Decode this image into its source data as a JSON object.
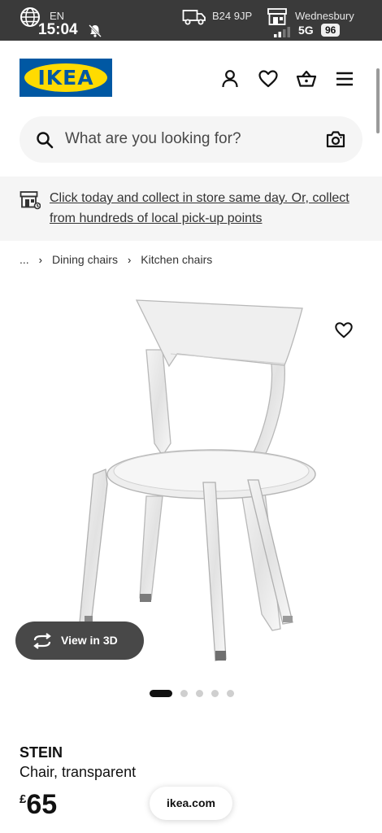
{
  "status_bar": {
    "lang": "EN",
    "time": "15:04",
    "postcode": "B24 9JP",
    "location": "Wednesbury",
    "network": "5G",
    "battery": "96"
  },
  "header": {
    "logo_text": "IKEA",
    "icons": [
      "user-icon",
      "heart-icon",
      "basket-icon",
      "menu-icon"
    ]
  },
  "search": {
    "placeholder": "What are you looking for?"
  },
  "banner": {
    "text": "Click today and collect in store same day. Or, collect from hundreds of local pick-up points"
  },
  "breadcrumb": {
    "ellipsis": "...",
    "items": [
      "Dining chairs",
      "Kitchen chairs"
    ]
  },
  "product": {
    "view3d_label": "View in 3D",
    "carousel": {
      "count": 5,
      "active": 0
    },
    "name": "STEIN",
    "description": "Chair, transparent",
    "currency": "£",
    "price": "65"
  },
  "browser": {
    "url": "ikea.com"
  },
  "colors": {
    "ikea_blue": "#0058a3",
    "ikea_yellow": "#ffdb00"
  }
}
